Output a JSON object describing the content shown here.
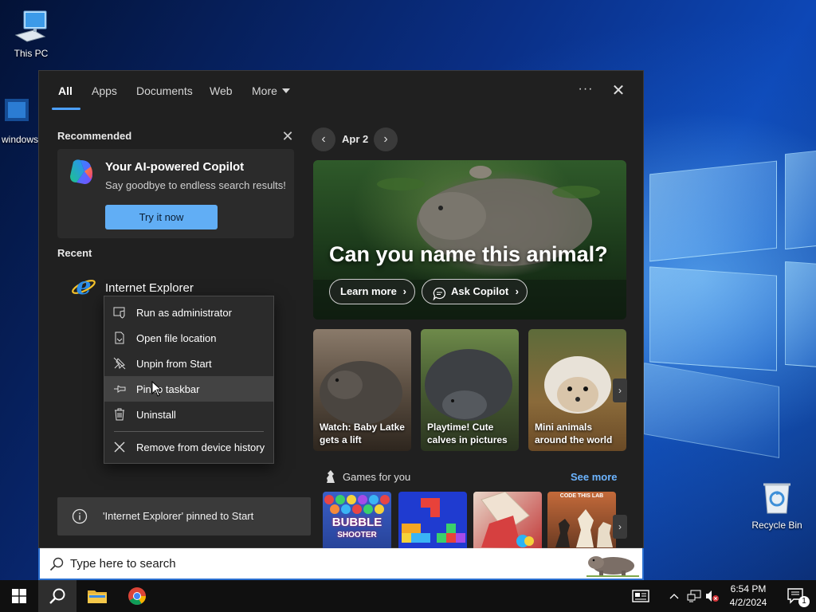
{
  "desktop": {
    "icons": [
      {
        "label": "This PC"
      },
      {
        "label": "windows"
      },
      {
        "label": "Recycle Bin"
      }
    ]
  },
  "search_panel": {
    "tabs": [
      {
        "label": "All",
        "active": true
      },
      {
        "label": "Apps"
      },
      {
        "label": "Documents"
      },
      {
        "label": "Web"
      },
      {
        "label": "More"
      }
    ],
    "header_buttons": {
      "options": "···",
      "close": "✕"
    },
    "recommended": {
      "title": "Recommended",
      "close": "✕",
      "copilot_card": {
        "title": "Your AI-powered Copilot",
        "subtitle": "Say goodbye to endless search results!",
        "button": "Try it now"
      }
    },
    "recent": {
      "title": "Recent",
      "items": [
        {
          "label": "Internet Explorer",
          "icon": "internet-explorer-icon"
        }
      ]
    },
    "context_menu": {
      "items": [
        {
          "label": "Run as administrator",
          "icon": "shield-window-icon"
        },
        {
          "label": "Open file location",
          "icon": "file-location-icon"
        },
        {
          "label": "Unpin from Start",
          "icon": "unpin-icon"
        },
        {
          "label": "Pin to taskbar",
          "icon": "pin-icon",
          "hover": true
        },
        {
          "label": "Uninstall",
          "icon": "trash-icon"
        },
        {
          "label": "Remove from device history",
          "icon": "close-icon"
        }
      ]
    },
    "toast": {
      "text": "'Internet Explorer' pinned to Start",
      "icon": "info-icon"
    },
    "highlights": {
      "date": "Apr 2",
      "prev": "‹",
      "next": "›",
      "hero": {
        "title": "Can you name this animal?",
        "buttons": [
          {
            "label": "Learn more"
          },
          {
            "label": "Ask Copilot"
          }
        ]
      },
      "cards": [
        {
          "caption": "Watch: Baby Latke gets a lift"
        },
        {
          "caption": "Playtime! Cute calves in pictures"
        },
        {
          "caption": "Mini animals around the world"
        }
      ],
      "games": {
        "title": "Games for you",
        "see_more": "See more",
        "tiles": [
          {
            "text_line1": "BUBBLE",
            "text_line2": "SHOOTER"
          },
          {
            "text_line1": ""
          },
          {
            "text_line1": ""
          },
          {
            "text_line1": "CODE THIS LAB"
          }
        ]
      }
    }
  },
  "search_box": {
    "placeholder": "Type here to search",
    "value": ""
  },
  "taskbar": {
    "clock": {
      "time": "6:54 PM",
      "date": "4/2/2024"
    },
    "notification_count": "1"
  },
  "colors": {
    "accent": "#4ca0ff",
    "try_button": "#61aef5",
    "see_more": "#6cb4ff",
    "panel_bg": "#202020",
    "taskbar_bg": "#101010"
  }
}
